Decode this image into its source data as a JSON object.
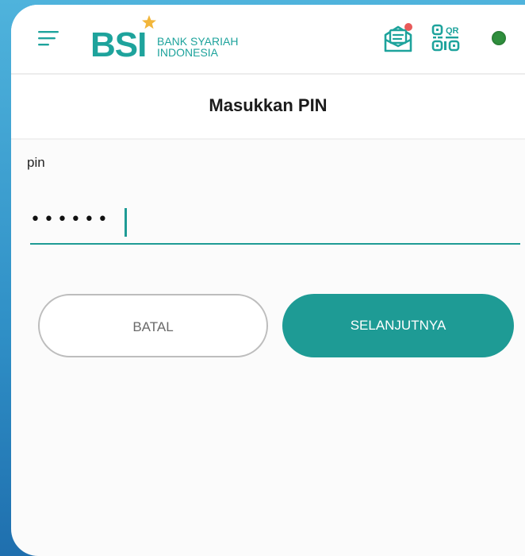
{
  "header": {
    "logo_text": "BSI",
    "logo_subtitle_line1": "BANK SYARIAH",
    "logo_subtitle_line2": "INDONESIA",
    "icons": [
      "menu-icon",
      "mail-icon",
      "qr-code-icon",
      "status-dot"
    ]
  },
  "page": {
    "title": "Masukkan PIN"
  },
  "form": {
    "pin_label": "pin",
    "pin_value": "••••••"
  },
  "buttons": {
    "cancel_label": "BATAL",
    "next_label": "SELANJUTNYA"
  },
  "colors": {
    "accent": "#1e9b95",
    "logo_teal": "#1ea39c",
    "notification": "#e85a5a",
    "status_online": "#2f8f3d",
    "background_gradient_top": "#4fb3dc",
    "background_gradient_bottom": "#1f6fae"
  }
}
